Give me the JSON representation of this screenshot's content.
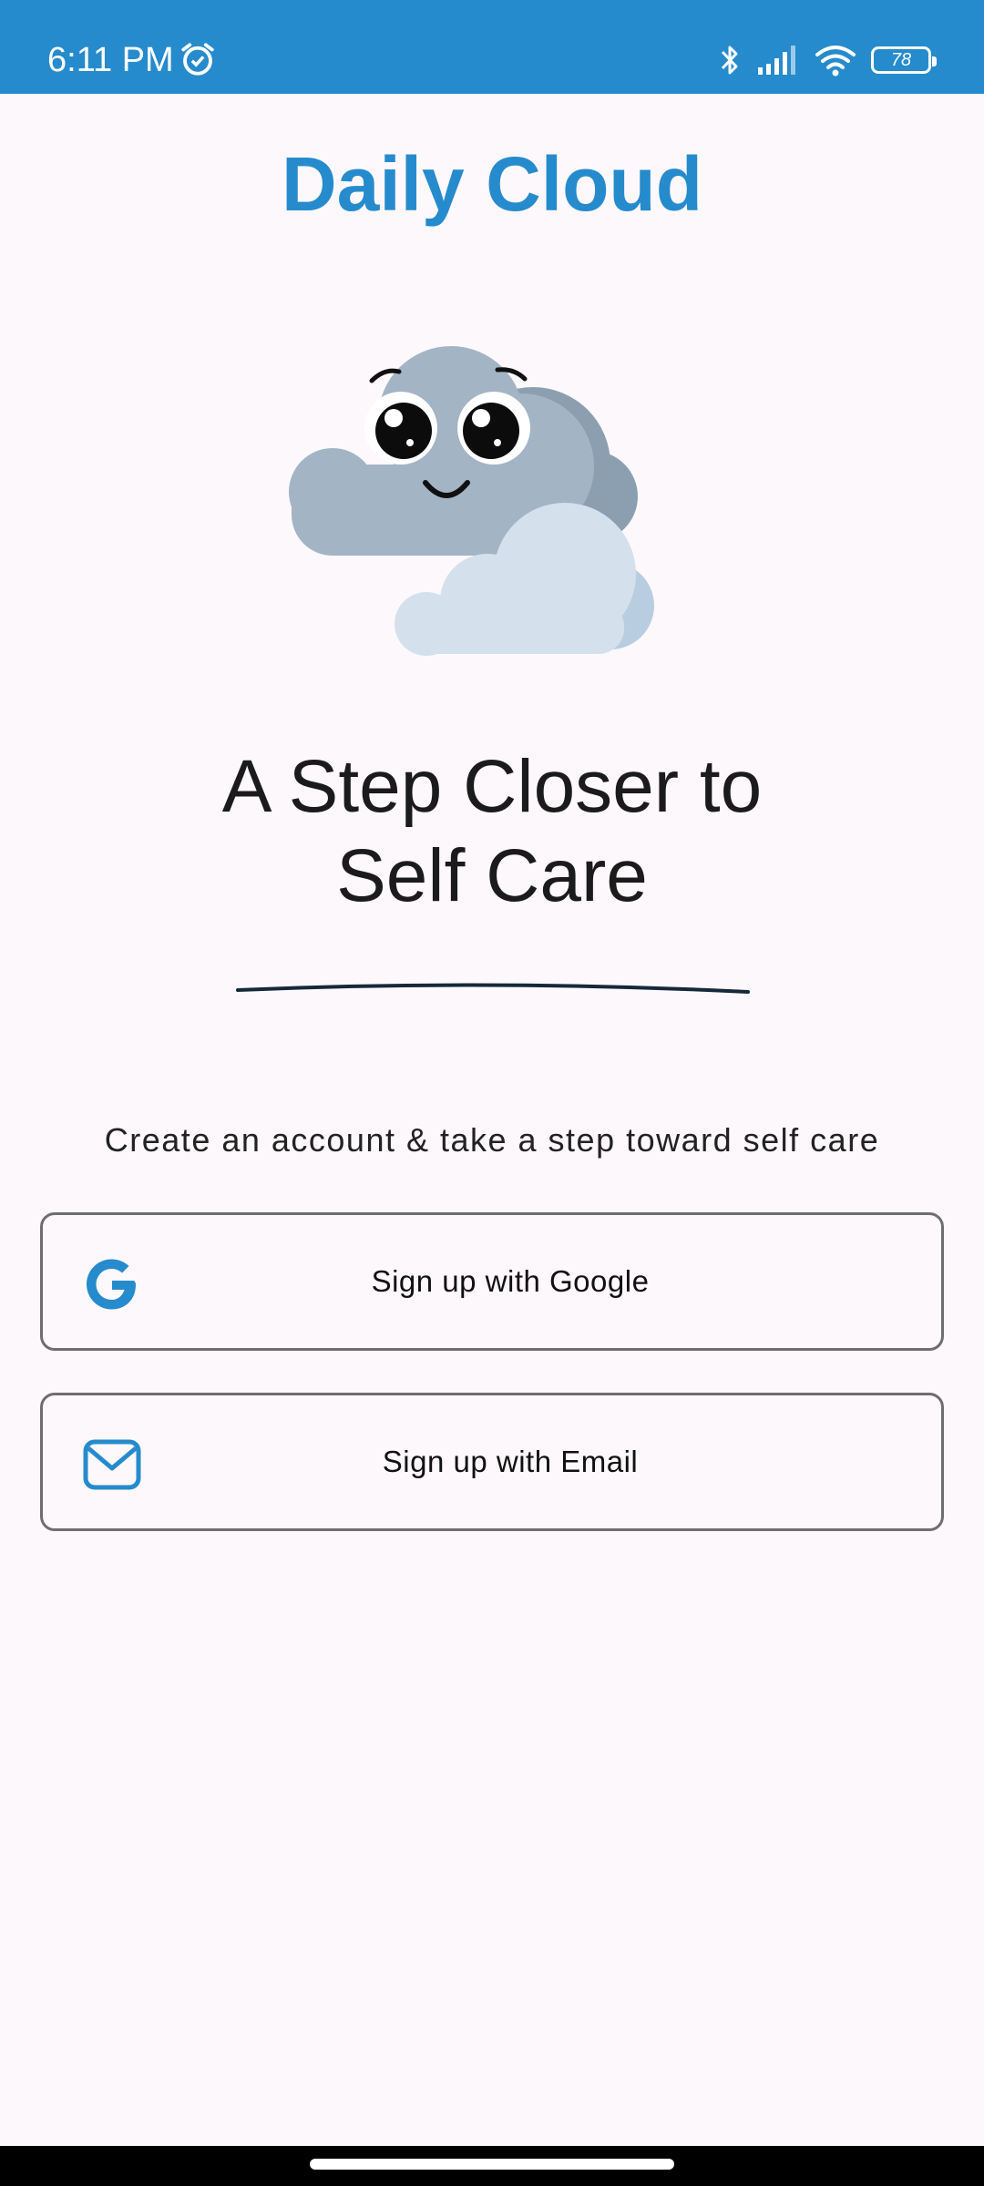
{
  "status_bar": {
    "time": "6:11 PM",
    "battery_level": "78",
    "icons": [
      "alarm-icon",
      "bluetooth-icon",
      "signal-icon",
      "wifi-icon",
      "battery-icon"
    ]
  },
  "app": {
    "title": "Daily Cloud"
  },
  "hero": {
    "headline_line1": "A Step Closer to",
    "headline_line2": "Self Care",
    "subtitle": "Create an account & take a step toward self care"
  },
  "buttons": {
    "google_label": "Sign up with Google",
    "email_label": "Sign up with Email"
  },
  "colors": {
    "brand": "#268bcc",
    "background": "#fdf8fb",
    "text": "#1b1b1b",
    "border": "#6e6e6e"
  }
}
